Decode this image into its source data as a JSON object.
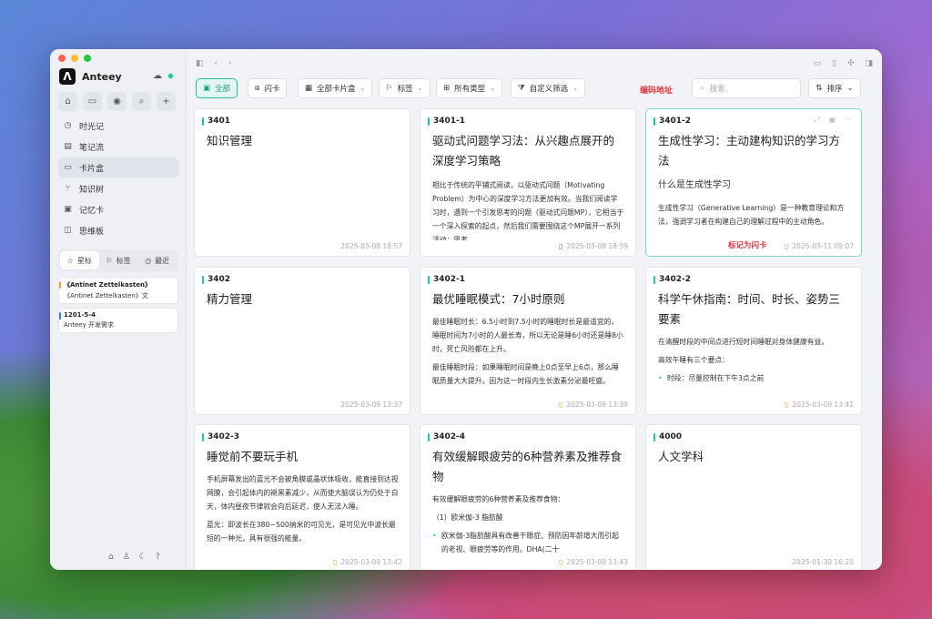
{
  "app": {
    "name": "Anteey"
  },
  "sidebar": {
    "nav": [
      {
        "label": "时光记",
        "icon": "clock-icon",
        "glyph": "◷"
      },
      {
        "label": "笔记流",
        "icon": "notes-icon",
        "glyph": "▤"
      },
      {
        "label": "卡片盒",
        "icon": "card-box-icon",
        "glyph": "▭"
      },
      {
        "label": "知识树",
        "icon": "tree-icon",
        "glyph": "⑂"
      },
      {
        "label": "记忆卡",
        "icon": "memory-card-icon",
        "glyph": "▣"
      },
      {
        "label": "思维板",
        "icon": "mind-board-icon",
        "glyph": "◫"
      }
    ],
    "tabs": {
      "starred": "星标",
      "tags": "标签",
      "recent": "最近"
    },
    "starred_items": [
      {
        "title": "《Antinet Zettelkasten》",
        "sub": "《Antinet Zettelkasten》文"
      },
      {
        "title": "1201-5-4",
        "sub": "Anteey 开发需求"
      }
    ]
  },
  "filters": {
    "all": "全部",
    "flashcard": "闪卡",
    "all_boxes": "全部卡片盒",
    "tags": "标签",
    "all_types": "所有类型",
    "custom_filter": "自定义筛选",
    "encode_address": "编码地址",
    "search_placeholder": "搜索",
    "sort": "排序"
  },
  "cards": [
    {
      "id": "3401",
      "title": "知识管理",
      "date": "2025-03-08 18:57"
    },
    {
      "id": "3401-1",
      "title": "驱动式问题学习法：从兴趣点展开的深度学习策略",
      "body": [
        "相比于传统的平铺式阅读，以驱动式问题（Motivating Problem）为中心的深度学习方法更加有效。当我们阅读学习时，遇到一个引发思考的问题（驱动式问题MP），它相当于一个深入探索的起点，然后我们需要围绕这个MP展开一系列活动：思考、"
      ],
      "date": "2025-03-08 18:59"
    },
    {
      "id": "3401-2",
      "title": "生成性学习：主动建构知识的学习方法",
      "heading": "什么是生成性学习",
      "body": [
        "生成性学习（Generative Learning）是一种教育理论和方法，强调学习者在构建自己的理解过程中的主动角色。"
      ],
      "flash_label": "标记为闪卡",
      "date": "2025-03-11 09:07"
    },
    {
      "id": "3402",
      "title": "精力管理",
      "date": "2025-03-09 13:37"
    },
    {
      "id": "3402-1",
      "title": "最优睡眠模式：7小时原则",
      "body": [
        "最佳睡眠时长：6.5小时到7.5小时的睡眠时长是最适宜的，睡眠时间为7小时的人最长寿，所以无论是睡6小时还是睡8小时，死亡风险都在上升。",
        "最佳睡眠时段：如果睡眠时间是晚上0点至早上6点，那么睡眠质量大大提升。因为这一时段内生长激素分泌最旺盛。"
      ],
      "date": "2025-03-09 13:39"
    },
    {
      "id": "3402-2",
      "title": "科学午休指南：时间、时长、姿势三要素",
      "body": [
        "在清醒时段的中间点进行短时间睡眠对身体健康有益。",
        "高效午睡有三个要点："
      ],
      "bullets": [
        "时段：尽量控制在下午3点之前"
      ],
      "date": "2025-03-09 13:41"
    },
    {
      "id": "3402-3",
      "title": "睡觉前不要玩手机",
      "body": [
        "手机屏幕发出的蓝光不会被角膜或晶状体吸收，能直接到达视网膜，会引起体内的褪黑素减少，从而使大脑误认为仍处于白天，体内昼夜节律就会向后延迟，使人无法入睡。",
        "蓝光：即波长在380~500纳米的可见光，是可见光中波长最短的一种光，具有很强的能量。"
      ],
      "date": "2025-03-09 13:42"
    },
    {
      "id": "3402-4",
      "title": "有效缓解眼疲劳的6种营养素及推荐食物",
      "body": [
        "有效缓解眼疲劳的6种营养素及推荐食物：",
        "（1）欧米伽-3 脂肪酸"
      ],
      "bullets": [
        "欧米伽-3脂肪酸具有改善干眼症、预防因年龄增大而引起的老视、眼疲劳等的作用。DHA(二十"
      ],
      "date": "2025-03-09 13:43"
    },
    {
      "id": "4000",
      "title": "人文学科",
      "date": "2025-01-30 16:20"
    }
  ]
}
